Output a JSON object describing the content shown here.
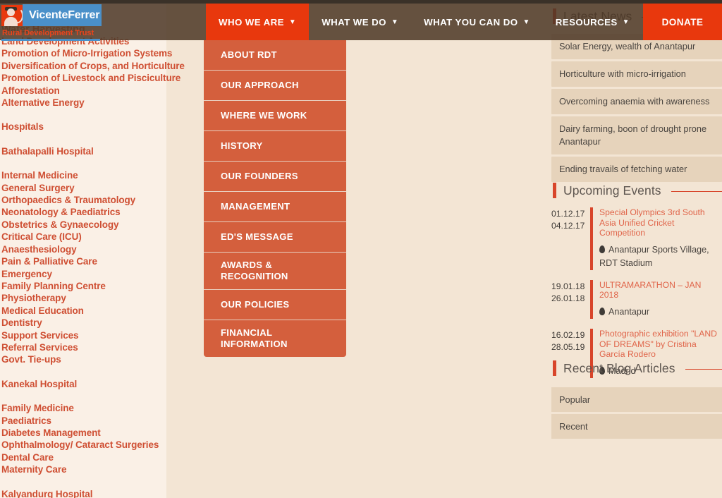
{
  "brand": {
    "name_part1": "Vicente",
    "name_part2": "Ferrer",
    "tagline": "Rural Development Trust",
    "logo_icon": "portrait-icon"
  },
  "background_heading": "Water Harvesting",
  "topnav": {
    "items": [
      {
        "label": "WHO WE ARE",
        "caret": "▼",
        "active": true
      },
      {
        "label": "WHAT WE DO",
        "caret": "▼",
        "active": false
      },
      {
        "label": "WHAT YOU CAN DO",
        "caret": "▼",
        "active": false
      },
      {
        "label": "RESOURCES",
        "caret": "▼",
        "active": false
      }
    ],
    "donate_label": "DONATE",
    "accent_color": "#e8380d",
    "bar_color": "#4d3826"
  },
  "dropdown": {
    "parent": "WHO WE ARE",
    "items": [
      {
        "label": "ABOUT RDT"
      },
      {
        "label": "OUR APPROACH"
      },
      {
        "label": "WHERE WE WORK"
      },
      {
        "label": "HISTORY"
      },
      {
        "label": "OUR FOUNDERS"
      },
      {
        "label": "MANAGEMENT"
      },
      {
        "label": "ED'S MESSAGE"
      },
      {
        "label": "AWARDS & RECOGNITION"
      },
      {
        "label": "OUR POLICIES"
      },
      {
        "label": "FINANCIAL INFORMATION"
      }
    ]
  },
  "left_column": {
    "items": [
      {
        "label": "Land Development Activities",
        "spaced": false
      },
      {
        "label": "Promotion of Micro-Irrigation Systems",
        "spaced": false
      },
      {
        "label": "Diversification of Crops, and Horticulture",
        "spaced": false
      },
      {
        "label": "Promotion of Livestock and Pisciculture",
        "spaced": false
      },
      {
        "label": "Afforestation",
        "spaced": false
      },
      {
        "label": "Alternative Energy",
        "spaced": false
      },
      {
        "label": "Hospitals",
        "spaced": true
      },
      {
        "label": "Bathalapalli Hospital",
        "spaced": true
      },
      {
        "label": "Internal Medicine",
        "spaced": true
      },
      {
        "label": "General Surgery",
        "spaced": false
      },
      {
        "label": "Orthopaedics & Traumatology",
        "spaced": false
      },
      {
        "label": "Neonatology & Paediatrics",
        "spaced": false
      },
      {
        "label": "Obstetrics & Gynaecology",
        "spaced": false
      },
      {
        "label": "Critical Care (ICU)",
        "spaced": false
      },
      {
        "label": "Anaesthesiology",
        "spaced": false
      },
      {
        "label": "Pain & Palliative Care",
        "spaced": false
      },
      {
        "label": "Emergency",
        "spaced": false
      },
      {
        "label": "Family Planning Centre",
        "spaced": false
      },
      {
        "label": "Physiotherapy",
        "spaced": false
      },
      {
        "label": "Medical Education",
        "spaced": false
      },
      {
        "label": "Dentistry",
        "spaced": false
      },
      {
        "label": "Support Services",
        "spaced": false
      },
      {
        "label": "Referral Services",
        "spaced": false
      },
      {
        "label": "Govt. Tie-ups",
        "spaced": false
      },
      {
        "label": "Kanekal Hospital",
        "spaced": true
      },
      {
        "label": "Family Medicine",
        "spaced": true
      },
      {
        "label": "Paediatrics",
        "spaced": false
      },
      {
        "label": "Diabetes Management",
        "spaced": false
      },
      {
        "label": "Ophthalmology/ Cataract Surgeries",
        "spaced": false
      },
      {
        "label": "Dental Care",
        "spaced": false
      },
      {
        "label": "Maternity Care",
        "spaced": false
      },
      {
        "label": "Kalyandurg Hospital",
        "spaced": true
      }
    ]
  },
  "sidebar": {
    "latest_news": {
      "title": "Latest News",
      "items": [
        "Solar Energy, wealth of Anantapur",
        "Horticulture with micro-irrigation",
        "Overcoming anaemia with awareness",
        "Dairy farming, boon of drought prone Anantapur",
        "Ending travails of fetching water"
      ]
    },
    "upcoming_events": {
      "title": "Upcoming Events",
      "events": [
        {
          "date_start": "01.12.17",
          "date_end": "04.12.17",
          "name": "Special Olympics 3rd South Asia Unified Cricket Competition",
          "location": "Anantapur Sports Village, RDT Stadium",
          "pin": "📍"
        },
        {
          "date_start": "19.01.18",
          "date_end": "26.01.18",
          "name": "ULTRAMARATHON – JAN 2018",
          "location": "Anantapur",
          "pin": "📍"
        },
        {
          "date_start": "16.02.19",
          "date_end": "28.05.19",
          "name": "Photographic exhibition \"LAND OF DREAMS\" by Cristina García Rodero",
          "location": "Madrid",
          "pin": "📍"
        }
      ]
    },
    "recent_blog": {
      "title": "Recent Blog Articles",
      "tabs": [
        "Popular",
        "Recent"
      ]
    }
  },
  "colors": {
    "accent_red": "#d8452a",
    "orange": "#e8380d",
    "dropdown_bg": "#d45f3d",
    "page_bg": "#f3e5d4",
    "left_bg": "#faf0e6",
    "news_box": "#e6d3bb",
    "link_red": "#cf4f33",
    "nav_brown": "#4d3826",
    "logo_blue": "#4a90c9"
  }
}
